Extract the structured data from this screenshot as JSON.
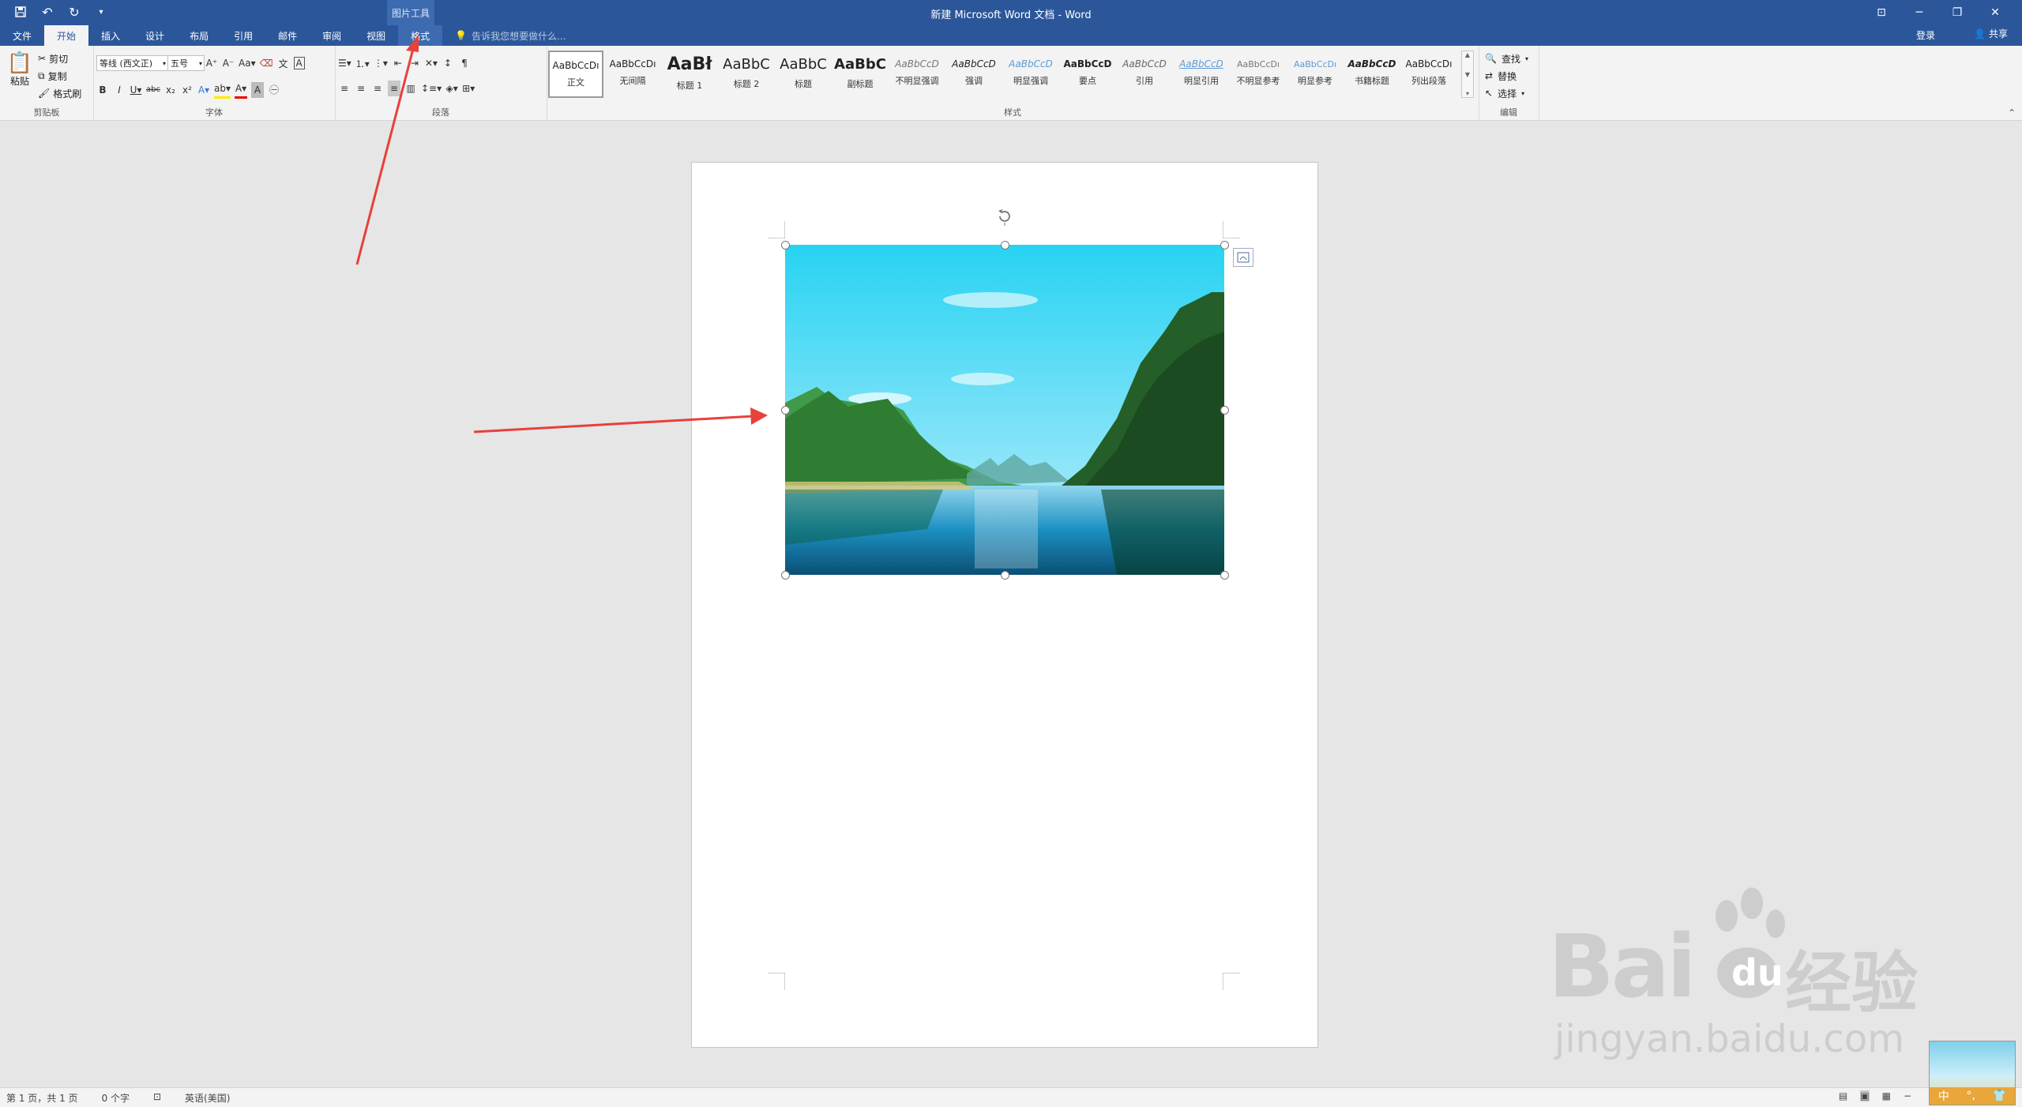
{
  "titlebar": {
    "doc_title": "新建 Microsoft Word 文档 - Word",
    "context_tool": "图片工具",
    "login": "登录",
    "share": "共享",
    "tell_me_placeholder": "告诉我您想要做什么..."
  },
  "tabs": [
    {
      "label": "文件"
    },
    {
      "label": "开始",
      "active": true
    },
    {
      "label": "插入"
    },
    {
      "label": "设计"
    },
    {
      "label": "布局"
    },
    {
      "label": "引用"
    },
    {
      "label": "邮件"
    },
    {
      "label": "审阅"
    },
    {
      "label": "视图"
    },
    {
      "label": "格式",
      "contextual": true
    }
  ],
  "ribbon": {
    "clipboard": {
      "label": "剪贴板",
      "paste": "粘贴",
      "cut": "剪切",
      "copy": "复制",
      "format_painter": "格式刷"
    },
    "font": {
      "label": "字体",
      "font_name": "等线 (西文正)",
      "font_size": "五号"
    },
    "paragraph": {
      "label": "段落"
    },
    "styles": {
      "label": "样式",
      "items": [
        {
          "preview": "AaBbCcDı",
          "name": "正文"
        },
        {
          "preview": "AaBbCcDı",
          "name": "无间隔"
        },
        {
          "preview": "AaBł",
          "name": "标题 1"
        },
        {
          "preview": "AaBbC",
          "name": "标题 2"
        },
        {
          "preview": "AaBbC",
          "name": "标题"
        },
        {
          "preview": "AaBbC",
          "name": "副标题"
        },
        {
          "preview": "AaBbCcD",
          "name": "不明显强调"
        },
        {
          "preview": "AaBbCcD",
          "name": "强调"
        },
        {
          "preview": "AaBbCcD",
          "name": "明显强调"
        },
        {
          "preview": "AaBbCcD",
          "name": "要点"
        },
        {
          "preview": "AaBbCcD",
          "name": "引用"
        },
        {
          "preview": "AaBbCcD",
          "name": "明显引用"
        },
        {
          "preview": "AaBbCcDı",
          "name": "不明显参考"
        },
        {
          "preview": "AaBbCcDı",
          "name": "明显参考"
        },
        {
          "preview": "AaBbCcD",
          "name": "书籍标题"
        },
        {
          "preview": "AaBbCcDı",
          "name": "列出段落"
        }
      ]
    },
    "editing": {
      "label": "编辑",
      "find": "查找",
      "replace": "替换",
      "select": "选择"
    }
  },
  "statusbar": {
    "page": "第 1 页，共 1 页",
    "words": "0 个字",
    "language": "英语(美国)"
  },
  "ime": {
    "label": "中"
  },
  "watermark": {
    "brand": "Bai",
    "cn": "经验",
    "url": "jingyan.baidu.com"
  },
  "colors": {
    "accent": "#2b579a",
    "arrow": "#e8403a"
  }
}
